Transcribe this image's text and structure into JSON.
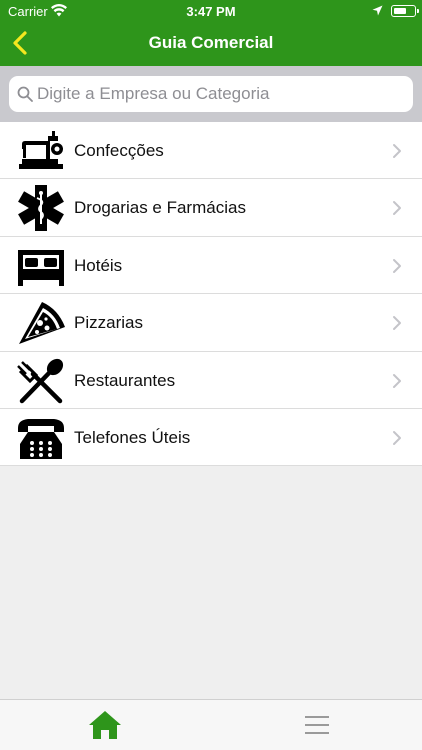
{
  "status": {
    "carrier": "Carrier",
    "time": "3:47 PM"
  },
  "header": {
    "title": "Guia Comercial"
  },
  "search": {
    "placeholder": "Digite a Empresa ou Categoria"
  },
  "categories": [
    {
      "label": "Confecções",
      "icon": "sewing-machine-icon"
    },
    {
      "label": "Drogarias e Farmácias",
      "icon": "star-of-life-icon"
    },
    {
      "label": "Hotéis",
      "icon": "bed-icon"
    },
    {
      "label": "Pizzarias",
      "icon": "pizza-slice-icon"
    },
    {
      "label": "Restaurantes",
      "icon": "fork-spoon-icon"
    },
    {
      "label": "Telefones Úteis",
      "icon": "telephone-icon"
    }
  ],
  "tabbar": {
    "items": [
      {
        "icon": "home-icon",
        "active": true
      },
      {
        "icon": "menu-icon",
        "active": false
      }
    ]
  },
  "colors": {
    "brand": "#2e951b",
    "back_arrow": "#f4e81f",
    "home_active": "#2e951b"
  }
}
